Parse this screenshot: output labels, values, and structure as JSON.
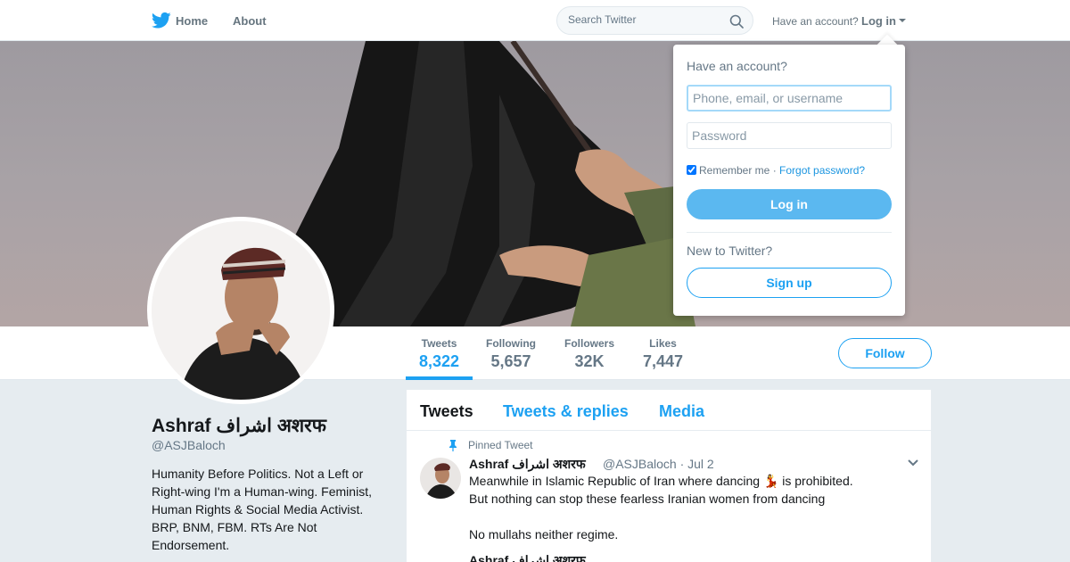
{
  "nav": {
    "home_label": "Home",
    "about_label": "About",
    "search_placeholder": "Search Twitter",
    "have_account": "Have an account?",
    "login_label": "Log in"
  },
  "profile": {
    "name": "Ashraf اشراف अशरफ",
    "handle": "@ASJBaloch",
    "bio": "Humanity Before Politics. Not a Left or Right-wing I'm a Human-wing. Feminist, Human Rights & Social Media Activist. BRP, BNM, FBM. RTs Are Not Endorsement.",
    "stats": [
      {
        "label": "Tweets",
        "value": "8,322"
      },
      {
        "label": "Following",
        "value": "5,657"
      },
      {
        "label": "Followers",
        "value": "32K"
      },
      {
        "label": "Likes",
        "value": "7,447"
      }
    ],
    "follow_label": "Follow"
  },
  "timeline": {
    "tabs": [
      "Tweets",
      "Tweets & replies",
      "Media"
    ],
    "pinned_label": "Pinned Tweet",
    "tweet": {
      "name": "Ashraf اشراف अशरफ",
      "handle_date": "@ASJBaloch · Jul 2",
      "lines": [
        "Meanwhile in Islamic Republic of Iran where dancing 💃 is prohibited.",
        "But nothing can stop these fearless Iranian women from dancing",
        "",
        "No mullahs neither regime."
      ],
      "quoted_name": "Ashraf اشراف अशरफ"
    }
  },
  "login_dropdown": {
    "title": "Have an account?",
    "username_placeholder": "Phone, email, or username",
    "password_placeholder": "Password",
    "remember_label": "Remember me",
    "separator": " · ",
    "forgot_label": "Forgot password?",
    "login_button": "Log in",
    "new_label": "New to Twitter?",
    "signup_button": "Sign up"
  },
  "colors": {
    "accent": "#1da1f2",
    "login_button": "#5bb8f0"
  },
  "icons": [
    "twitter-bird-icon",
    "search-icon",
    "caret-down-icon",
    "pin-icon",
    "chevron-down-icon"
  ]
}
